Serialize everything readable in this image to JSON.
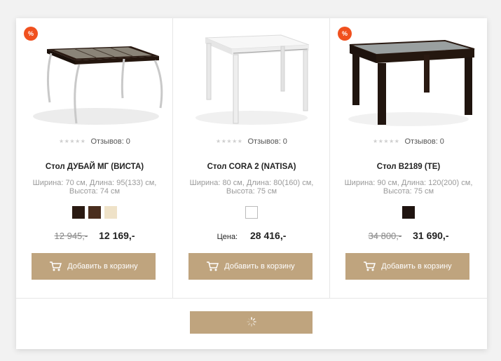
{
  "badge_text": "%",
  "stars": "★★★★★",
  "reviews_label": "Отзывов: 0",
  "cart_button_label": "Добавить в корзину",
  "products": [
    {
      "title": "Стол ДУБАЙ МГ (ВИСТА)",
      "dims": "Ширина: 70 см, Длина: 95(133) см, Высота: 74 см",
      "old_price": "12 945,-",
      "price": "12 169,-",
      "swatch_colors": [
        "#2a1a12",
        "#4a2e1e",
        "#efe2c8"
      ]
    },
    {
      "title": "Стол CORA 2 (NATISA)",
      "dims": "Ширина: 80 см, Длина: 80(160) см, Высота: 75 см",
      "price_label": "Цена:",
      "price": "28 416,-",
      "swatch_colors": [
        "#ffffff"
      ]
    },
    {
      "title": "Стол B2189 (TE)",
      "dims": "Ширина: 90 см, Длина: 120(200) см, Высота: 75 см",
      "old_price": "34 800,-",
      "price": "31 690,-",
      "swatch_colors": [
        "#1f1410"
      ]
    }
  ],
  "colors": {
    "accent": "#bfa47e",
    "badge": "#f0501e"
  }
}
